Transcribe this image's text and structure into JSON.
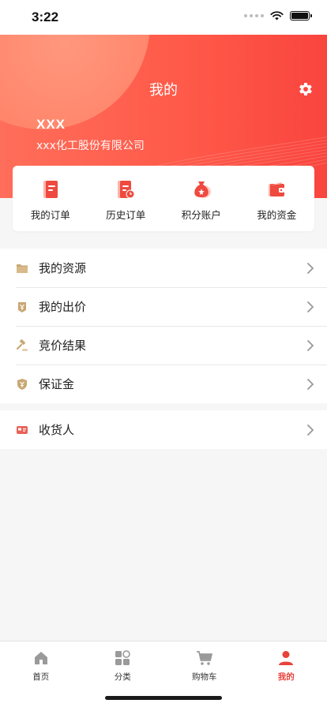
{
  "status_bar": {
    "time": "3:22"
  },
  "header": {
    "title": "我的",
    "user_name": "XXX",
    "company": "xxx化工股份有限公司"
  },
  "quick_actions": [
    {
      "label": "我的订单",
      "icon": "order-document-icon"
    },
    {
      "label": "历史订单",
      "icon": "history-order-icon"
    },
    {
      "label": "积分账户",
      "icon": "points-money-bag-icon"
    },
    {
      "label": "我的资金",
      "icon": "wallet-icon"
    }
  ],
  "menu_group_1": [
    {
      "label": "我的资源",
      "icon": "folder-icon"
    },
    {
      "label": "我的出价",
      "icon": "bid-price-icon"
    },
    {
      "label": "竞价结果",
      "icon": "auction-hammer-icon"
    },
    {
      "label": "保证金",
      "icon": "deposit-shield-icon"
    }
  ],
  "menu_group_2": [
    {
      "label": "收货人",
      "icon": "consignee-card-icon"
    }
  ],
  "tab_bar": {
    "items": [
      {
        "label": "首页",
        "icon": "home-icon",
        "active": false
      },
      {
        "label": "分类",
        "icon": "category-icon",
        "active": false
      },
      {
        "label": "购物车",
        "icon": "cart-icon",
        "active": false
      },
      {
        "label": "我的",
        "icon": "profile-icon",
        "active": true
      }
    ]
  },
  "colors": {
    "brand_red": "#f9453e",
    "header_gradient_start": "#ff6e5a",
    "icon_gold": "#c9a774",
    "tab_active": "#e8423b"
  }
}
